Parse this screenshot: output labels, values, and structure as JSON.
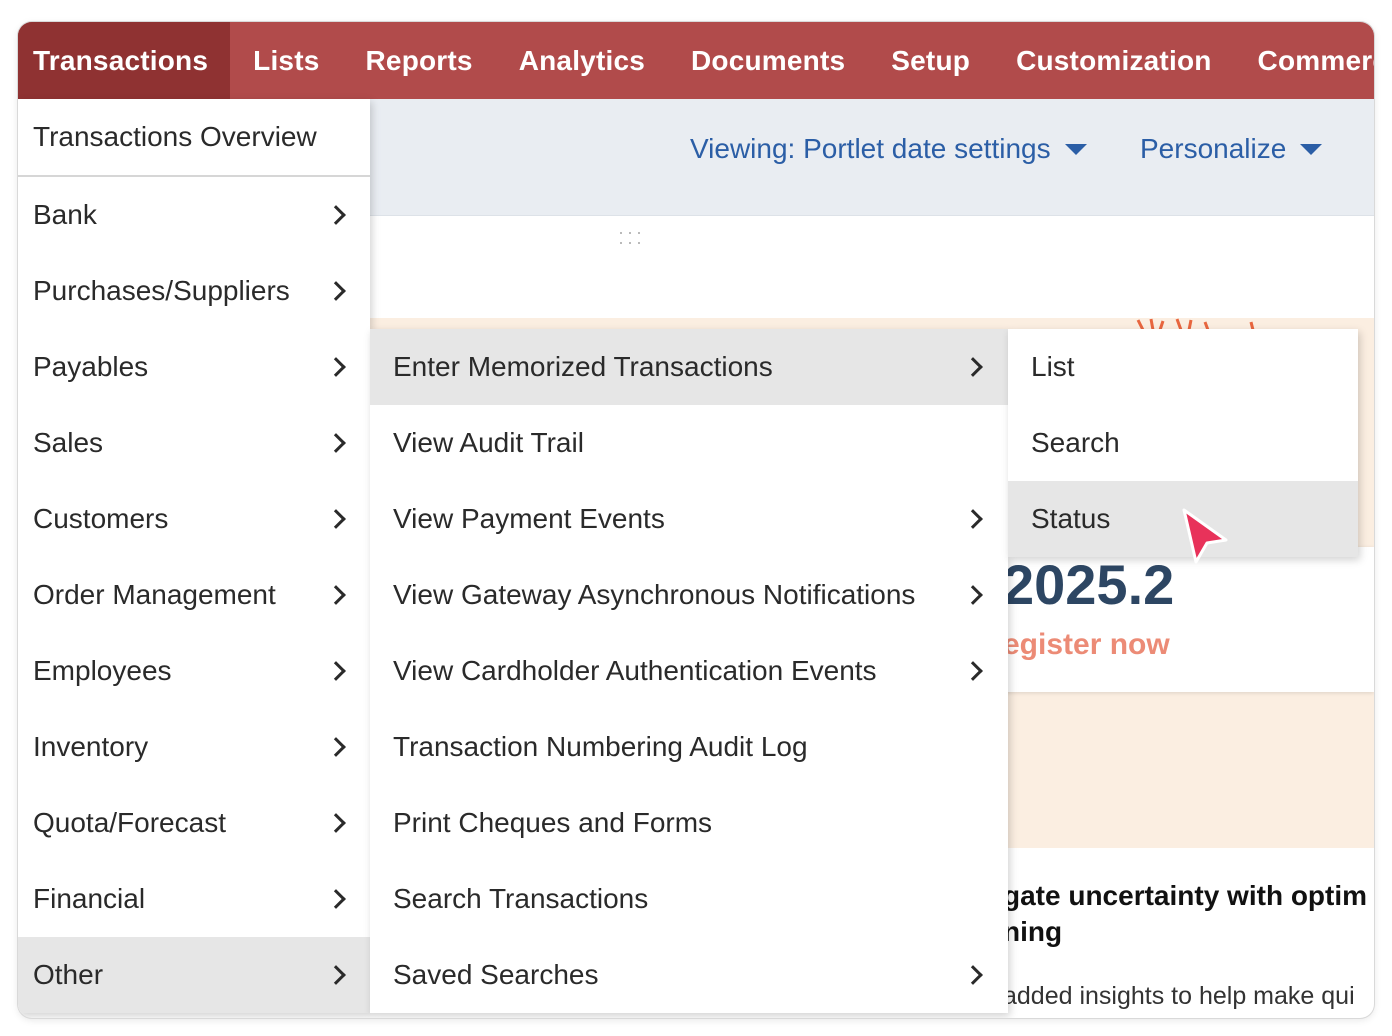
{
  "topnav": {
    "items": [
      {
        "label": "Transactions"
      },
      {
        "label": "Lists"
      },
      {
        "label": "Reports"
      },
      {
        "label": "Analytics"
      },
      {
        "label": "Documents"
      },
      {
        "label": "Setup"
      },
      {
        "label": "Customization"
      },
      {
        "label": "Commerce"
      }
    ]
  },
  "subheader": {
    "viewing": "Viewing: Portlet date settings",
    "personalize": "Personalize"
  },
  "banner": {
    "version": "2025.2",
    "register": "egister now",
    "article_title_1": "gate uncertainty with optim",
    "article_title_2": "ning",
    "article_desc": "added insights to help make qui"
  },
  "menu_level1": {
    "overview": "Transactions Overview",
    "items": [
      {
        "label": "Bank"
      },
      {
        "label": "Purchases/Suppliers"
      },
      {
        "label": "Payables"
      },
      {
        "label": "Sales"
      },
      {
        "label": "Customers"
      },
      {
        "label": "Order Management"
      },
      {
        "label": "Employees"
      },
      {
        "label": "Inventory"
      },
      {
        "label": "Quota/Forecast"
      },
      {
        "label": "Financial"
      },
      {
        "label": "Other"
      }
    ]
  },
  "menu_level2": {
    "items": [
      {
        "label": "Enter Memorized Transactions"
      },
      {
        "label": "View Audit Trail"
      },
      {
        "label": "View Payment Events"
      },
      {
        "label": "View Gateway Asynchronous Notifications"
      },
      {
        "label": "View Cardholder Authentication Events"
      },
      {
        "label": "Transaction Numbering Audit Log"
      },
      {
        "label": "Print Cheques and Forms"
      },
      {
        "label": "Search Transactions"
      },
      {
        "label": "Saved Searches"
      }
    ]
  },
  "menu_level3": {
    "items": [
      {
        "label": "List"
      },
      {
        "label": "Search"
      },
      {
        "label": "Status"
      }
    ]
  },
  "colors": {
    "nav_bg": "#b14b4b",
    "nav_active": "#8f3232",
    "link_blue": "#2b5ea6",
    "highlight": "#e6e6e6",
    "banner_bg": "#fbeee1",
    "cursor": "#e8325a"
  }
}
